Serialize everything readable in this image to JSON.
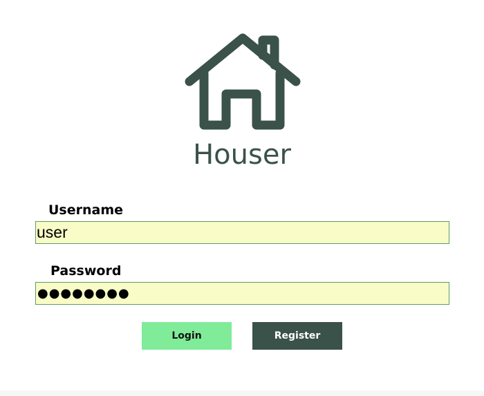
{
  "app": {
    "title": "Houser",
    "logo_icon": "house-icon",
    "brand_color": "#3a5249"
  },
  "form": {
    "username": {
      "label": "Username",
      "value": "user"
    },
    "password": {
      "label": "Password",
      "masked_value": "●●●●●●●●"
    },
    "input_background": "#f9fcc6",
    "input_border": "#5c9a63"
  },
  "buttons": {
    "login_label": "Login",
    "login_color": "#80eb99",
    "register_label": "Register",
    "register_color": "#3a5249"
  }
}
